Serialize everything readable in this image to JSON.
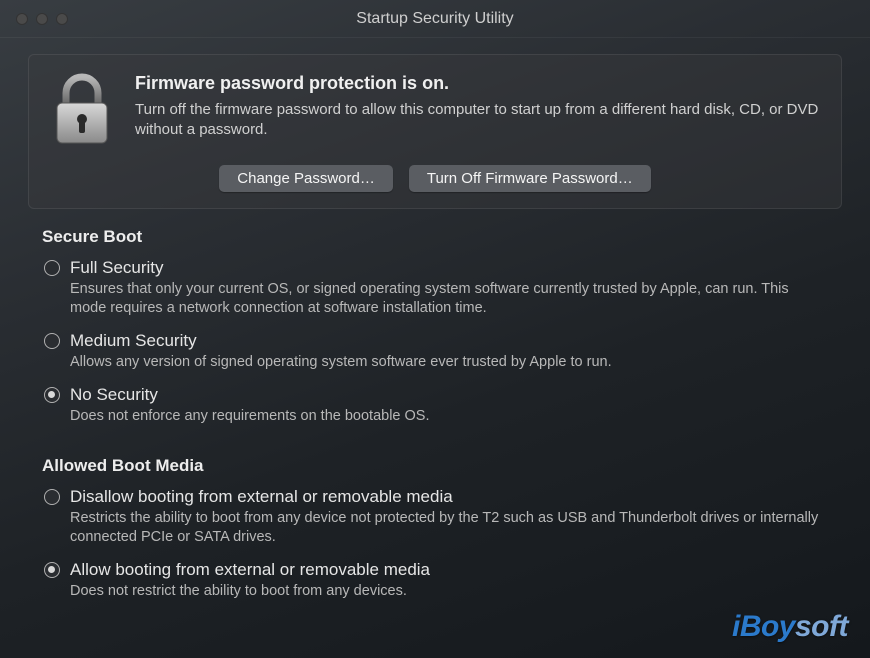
{
  "window": {
    "title": "Startup Security Utility"
  },
  "firmware": {
    "heading": "Firmware password protection is on.",
    "description": "Turn off the firmware password to allow this computer to start up from a different hard disk, CD, or DVD without a password.",
    "change_button": "Change Password…",
    "turnoff_button": "Turn Off Firmware Password…"
  },
  "secure_boot": {
    "header": "Secure Boot",
    "options": [
      {
        "title": "Full Security",
        "desc": "Ensures that only your current OS, or signed operating system software currently trusted by Apple, can run. This mode requires a network connection at software installation time.",
        "selected": false
      },
      {
        "title": "Medium Security",
        "desc": "Allows any version of signed operating system software ever trusted by Apple to run.",
        "selected": false
      },
      {
        "title": "No Security",
        "desc": "Does not enforce any requirements on the bootable OS.",
        "selected": true
      }
    ]
  },
  "boot_media": {
    "header": "Allowed Boot Media",
    "options": [
      {
        "title": "Disallow booting from external or removable media",
        "desc": "Restricts the ability to boot from any device not protected by the T2 such as USB and Thunderbolt drives or internally connected PCIe or SATA drives.",
        "selected": false
      },
      {
        "title": "Allow booting from external or removable media",
        "desc": "Does not restrict the ability to boot from any devices.",
        "selected": true
      }
    ]
  },
  "watermark": {
    "prefix": "iBoy",
    "suffix": "soft"
  }
}
